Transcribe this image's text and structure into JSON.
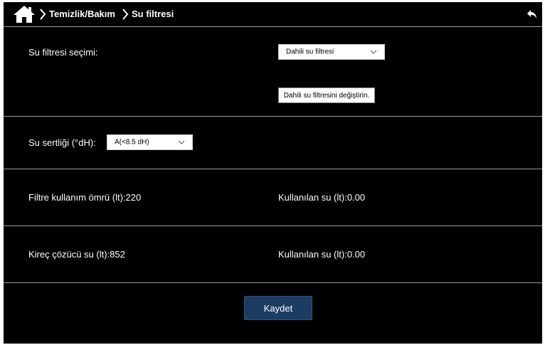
{
  "header": {
    "breadcrumb": [
      "Temizlik/Bakım",
      "Su filtresi"
    ]
  },
  "filter_selection": {
    "label": "Su filtresi seçimi:",
    "value": "Dahili su filtresi",
    "change_button": "Dahili su filtresini değiştirin."
  },
  "hardness": {
    "label": "Su sertliği (°dH):",
    "value": "A(<8.5 dH)"
  },
  "filter_life": {
    "label": "Filtre kullanım ömrü (lt):220",
    "used": "Kullanılan su (lt):0.00"
  },
  "descaler": {
    "label": "Kireç çözücü su (lt):852",
    "used": "Kullanılan su (lt):0.00"
  },
  "save_label": "Kaydet",
  "icons": {
    "home": "home-icon",
    "chevron": "chevron-right-icon",
    "back": "back-arrow-icon",
    "dropdown": "chevron-down-icon"
  }
}
